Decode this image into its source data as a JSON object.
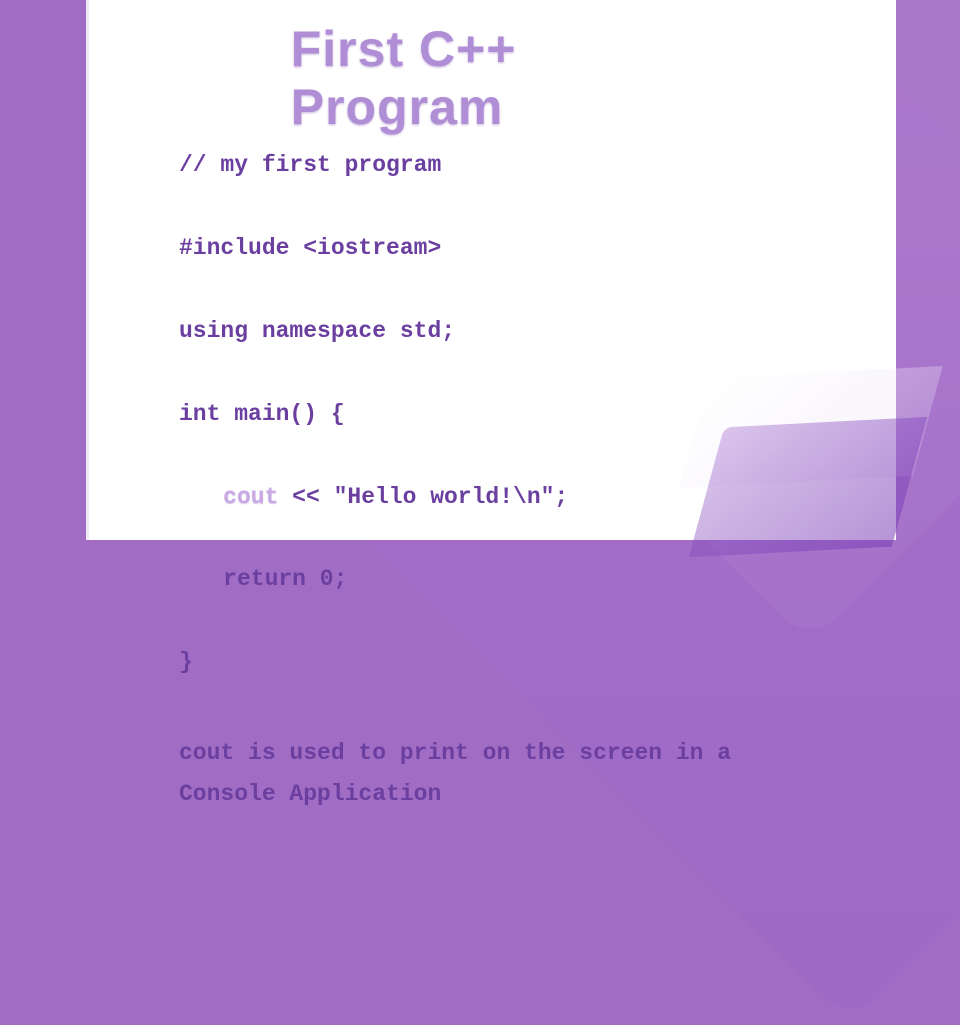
{
  "title": "First C++ Program",
  "code": {
    "line1": "// my first program",
    "line2": "#include <iostream>",
    "line3": "using namespace std;",
    "line4": "int main() {",
    "line5_cout": "cout",
    "line5_rest": " << \"Hello world!\\n\";",
    "line6": "return 0;",
    "line7": "}"
  },
  "note": "cout is used to print on the screen in a\nConsole Application"
}
